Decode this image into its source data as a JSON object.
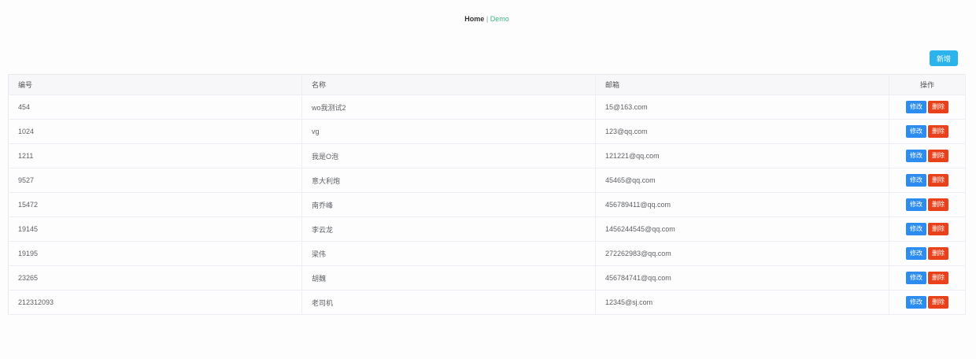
{
  "nav": {
    "home": "Home",
    "separator": "|",
    "current": "Demo"
  },
  "toolbar": {
    "add_label": "新增"
  },
  "table": {
    "headers": [
      "编号",
      "名称",
      "邮箱",
      "操作"
    ],
    "edit_label": "修改",
    "delete_label": "删除",
    "rows": [
      {
        "id": "454",
        "name": "wo我测试2",
        "email": "15@163.com"
      },
      {
        "id": "1024",
        "name": "vg",
        "email": "123@qq.com"
      },
      {
        "id": "1211",
        "name": "我是O泡",
        "email": "121221@qq.com"
      },
      {
        "id": "9527",
        "name": "意大利炮",
        "email": "45465@qq.com"
      },
      {
        "id": "15472",
        "name": "南乔峰",
        "email": "456789411@qq.com"
      },
      {
        "id": "19145",
        "name": "李云龙",
        "email": "1456244545@qq.com"
      },
      {
        "id": "19195",
        "name": "梁伟",
        "email": "272262983@qq.com"
      },
      {
        "id": "23265",
        "name": "胡魏",
        "email": "456784741@qq.com"
      },
      {
        "id": "212312093",
        "name": "老司机",
        "email": "12345@sj.com"
      }
    ]
  }
}
